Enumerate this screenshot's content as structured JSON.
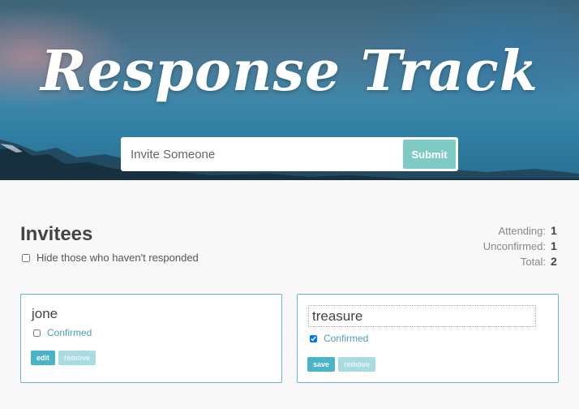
{
  "header": {
    "title": "Response Track",
    "invite_placeholder": "Invite Someone",
    "submit_label": "Submit"
  },
  "main": {
    "heading": "Invitees",
    "hide_label": "Hide those who haven't responded",
    "hide_checked": false,
    "counts": [
      {
        "label": "Attending:",
        "value": "1"
      },
      {
        "label": "Unconfirmed:",
        "value": "1"
      },
      {
        "label": "Total:",
        "value": "2"
      }
    ],
    "invitees": [
      {
        "name": "jone",
        "confirmed_label": "Confirmed",
        "confirmed": false,
        "editing": false,
        "primary_action": "edit",
        "remove_label": "remove"
      },
      {
        "name": "treasure",
        "confirmed_label": "Confirmed",
        "confirmed": true,
        "editing": true,
        "primary_action": "save",
        "remove_label": "remove"
      }
    ]
  },
  "colors": {
    "accent": "#4bb3c7",
    "submit": "#7fcac4",
    "card_border": "#6ab4c9"
  }
}
